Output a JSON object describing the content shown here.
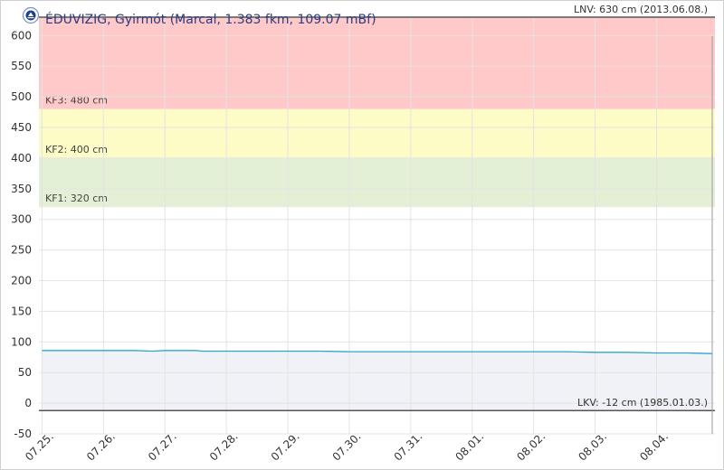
{
  "chart_data": {
    "type": "line",
    "title": "ÉDUVIZIG, Gyirmót (Marcal, 1.383 fkm, 109.07 mBf)",
    "xlabel": "",
    "ylabel": "",
    "ylim": [
      -50,
      630
    ],
    "yticks": [
      -50,
      0,
      50,
      100,
      150,
      200,
      250,
      300,
      350,
      400,
      450,
      500,
      550,
      600
    ],
    "xticks": [
      "07.25.",
      "07.26.",
      "07.27.",
      "07.28.",
      "07.29.",
      "07.30.",
      "07.31.",
      "08.01.",
      "08.02.",
      "08.03.",
      "08.04."
    ],
    "grid": true,
    "bands": [
      {
        "from": 480,
        "to": 630,
        "color": "#ffc9c9",
        "label": "KF3: 480 cm"
      },
      {
        "from": 400,
        "to": 480,
        "color": "#fdfbc6",
        "label": "KF2: 400 cm"
      },
      {
        "from": 320,
        "to": 400,
        "color": "#e4f0d6",
        "label": "KF1: 320 cm"
      }
    ],
    "reference_lines": [
      {
        "value": 630,
        "label": "LNV: 630 cm (2013.06.08.)",
        "color": "#555555"
      },
      {
        "value": -12,
        "label": "LKV: -12 cm (1985.01.03.)",
        "color": "#555555"
      }
    ],
    "series": [
      {
        "color": "#2aa7c9",
        "x": [
          0,
          0.5,
          1,
          1.5,
          1.8,
          2,
          2.5,
          2.6,
          3,
          3.5,
          4,
          4.5,
          5,
          5.5,
          6,
          6.5,
          7,
          7.5,
          8,
          8.5,
          9,
          9.5,
          10,
          10.5,
          10.9
        ],
        "y": [
          86,
          86,
          86,
          86,
          85,
          86,
          86,
          85,
          85,
          85,
          85,
          85,
          84,
          84,
          84,
          84,
          84,
          84,
          84,
          84,
          83,
          83,
          82,
          82,
          81
        ]
      }
    ]
  }
}
